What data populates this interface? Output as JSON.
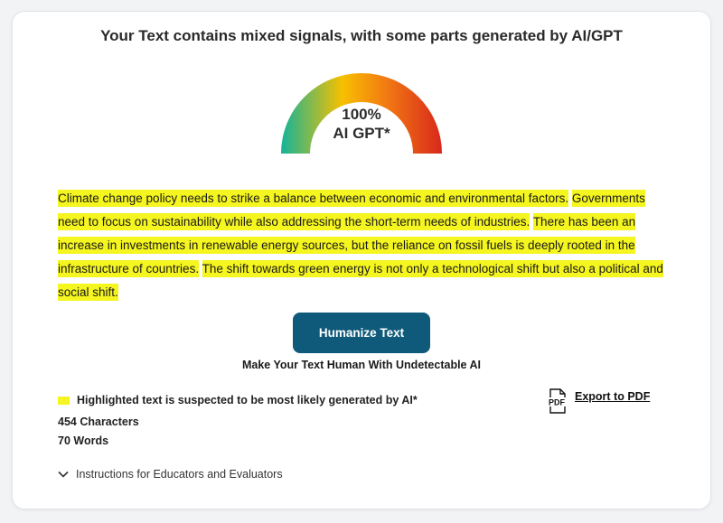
{
  "headline": "Your Text contains mixed signals, with some parts generated by AI/GPT",
  "gauge": {
    "percent_label": "100%",
    "result_label": "AI GPT*",
    "value": 1.0,
    "colors": [
      "#14b39a",
      "#f7c000",
      "#f27b12",
      "#d8281c"
    ]
  },
  "analyzed_text": {
    "sentences": [
      "Climate change policy needs to strike a balance between economic and environmental factors.",
      "Governments need to focus on sustainability while also addressing the short-term needs of industries.",
      "There has been an increase in investments in renewable energy sources, but the reliance on fossil fuels is deeply rooted in the infrastructure of countries.",
      "The shift towards green energy is not only a technological shift but also a political and social shift."
    ],
    "highlight_color": "#f5f520"
  },
  "humanize": {
    "button_label": "Humanize Text",
    "button_color": "#0f5a7a",
    "subtitle": "Make Your Text Human With Undetectable AI"
  },
  "legend": {
    "label": "Highlighted text is suspected to be most likely generated by AI*"
  },
  "stats": {
    "characters": "454 Characters",
    "words": "70 Words"
  },
  "export": {
    "label": "Export to PDF",
    "icon": "pdf-file-icon",
    "icon_text": "PDF"
  },
  "instructions": {
    "label": "Instructions for Educators and Evaluators",
    "icon": "chevron-down-icon"
  }
}
